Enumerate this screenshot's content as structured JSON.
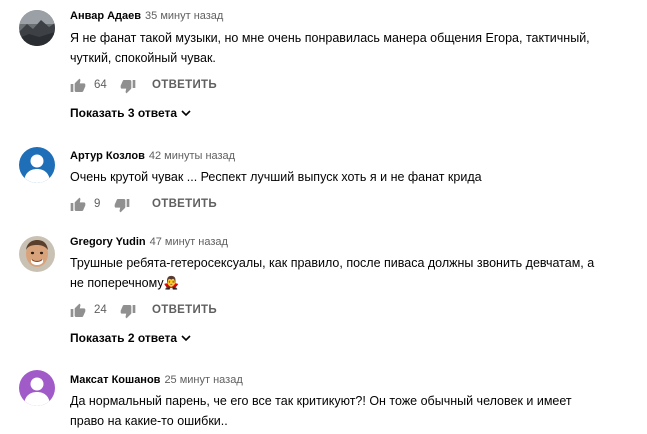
{
  "comments": [
    {
      "author": "Анвар Адаев",
      "time": "35 минут назад",
      "text_line1": "Я не фанат такой музыки, но мне очень понравилась манера общения Егора, тактичный,",
      "text_line2": "чуткий, спокойный чувак.",
      "likes": "64",
      "reply_label": "ОТВЕТИТЬ",
      "show_replies": "Показать 3 ответа",
      "avatar": "landscape-photo"
    },
    {
      "author": "Артур Козлов",
      "time": "42 минуты назад",
      "text_line1": "Очень крутой чувак ... Респект лучший выпуск хоть я и не фанат крида",
      "likes": "9",
      "reply_label": "ОТВЕТИТЬ",
      "avatar": "default-user-blue"
    },
    {
      "author": "Gregory Yudin",
      "time": "47 минут назад",
      "text_line1": "Трушные ребята-гетеросексуалы, как правило, после пиваса должны звонить девчатам, а",
      "text_line2": "не поперечному",
      "text_emoji": "🧛‍♂",
      "likes": "24",
      "reply_label": "ОТВЕТИТЬ",
      "show_replies": "Показать 2 ответа",
      "avatar": "face-photo"
    },
    {
      "author": "Максат Кошанов",
      "time": "25 минут назад",
      "text_line1": "Да нормальный парень, че его все так критикуют?! Он тоже обычный человек и имеет",
      "text_line2": "право на какие-то ошибки..",
      "avatar": "default-user-purple"
    }
  ],
  "colors": {
    "text": "#030303",
    "secondary": "#606060",
    "icon": "#909090",
    "avatar_blue": "#1e6fb8",
    "avatar_purple": "#a05bc8"
  }
}
